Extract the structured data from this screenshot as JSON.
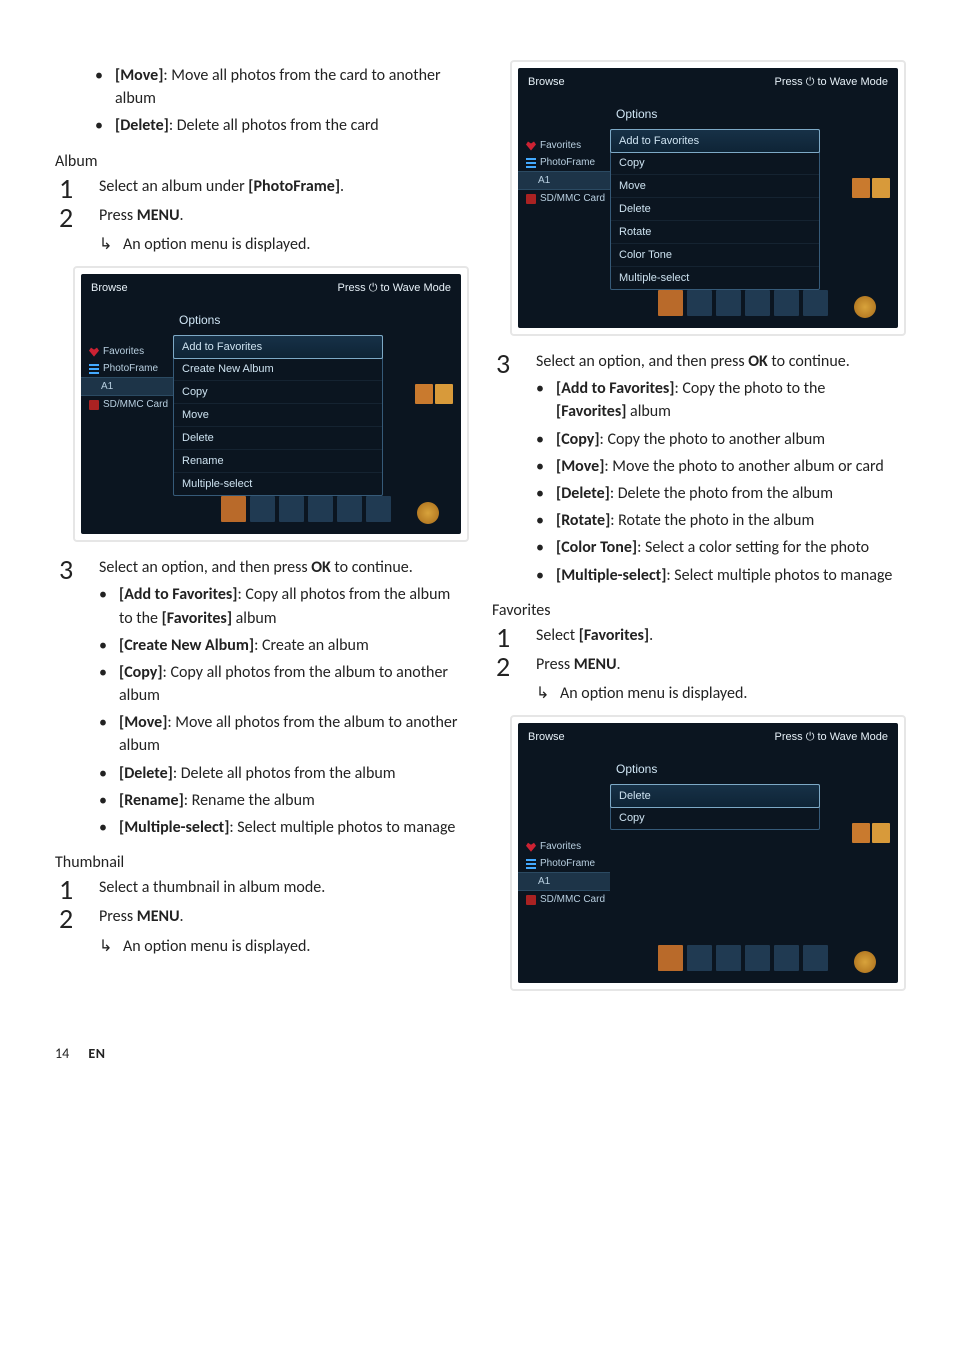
{
  "initial_bullets": [
    {
      "term": "[Move]",
      "desc": ": Move all photos from the card to another album"
    },
    {
      "term": "[Delete]",
      "desc": ": Delete all photos from the card"
    }
  ],
  "album": {
    "heading": "Album",
    "steps": [
      {
        "pre": "Select an album under ",
        "bold": "[PhotoFrame]",
        "post": "."
      },
      {
        "pre": "Press ",
        "bold": "MENU",
        "post": "."
      }
    ],
    "arrow": "An option menu is displayed.",
    "step3_pre": "Select an option, and then press ",
    "step3_bold": "OK",
    "step3_post": " to continue.",
    "bullets": [
      {
        "term": "[Add to Favorites]",
        "desc": ": Copy all photos from the album to the ",
        "bold2": "[Favorites]",
        "desc2": " album"
      },
      {
        "term": "[Create New Album]",
        "desc": ": Create an album"
      },
      {
        "term": "[Copy]",
        "desc": ": Copy all photos from the album to another album"
      },
      {
        "term": "[Move]",
        "desc": ": Move all photos from the album to another album"
      },
      {
        "term": "[Delete]",
        "desc": ": Delete all photos from the album"
      },
      {
        "term": "[Rename]",
        "desc": ": Rename the album"
      },
      {
        "term": "[Multiple-select]",
        "desc": ": Select multiple photos to manage"
      }
    ]
  },
  "thumbnail": {
    "heading": "Thumbnail",
    "steps": [
      {
        "text": "Select a thumbnail in album mode."
      },
      {
        "pre": "Press ",
        "bold": "MENU",
        "post": "."
      }
    ],
    "arrow": "An option menu is displayed.",
    "step3_pre": "Select an option, and then press ",
    "step3_bold": "OK",
    "step3_post": " to continue.",
    "bullets": [
      {
        "term": "[Add to Favorites]",
        "desc": ": Copy the photo to the ",
        "bold2": "[Favorites]",
        "desc2": " album"
      },
      {
        "term": "[Copy]",
        "desc": ": Copy the photo to another album"
      },
      {
        "term": "[Move]",
        "desc": ": Move the photo to another album or card"
      },
      {
        "term": "[Delete]",
        "desc": ": Delete the photo from the album"
      },
      {
        "term": "[Rotate]",
        "desc": ": Rotate the photo in the album"
      },
      {
        "term": "[Color Tone]",
        "desc": ": Select a color setting for the photo"
      },
      {
        "term": "[Multiple-select]",
        "desc": ": Select multiple photos to manage"
      }
    ]
  },
  "favorites": {
    "heading": "Favorites",
    "steps": [
      {
        "pre": "Select ",
        "bold": "[Favorites]",
        "post": "."
      },
      {
        "pre": "Press ",
        "bold": "MENU",
        "post": "."
      }
    ],
    "arrow": "An option menu is displayed."
  },
  "shot1": {
    "title": "Browse",
    "hint_pre": "Press ",
    "hint_icon": "⏻",
    "hint_post": " to Wave Mode",
    "menu_title": "Options",
    "items": [
      "Add to Favorites",
      "Create New Album",
      "Copy",
      "Move",
      "Delete",
      "Rename",
      "Multiple-select"
    ],
    "side": {
      "fav": "Favorites",
      "pf": "PhotoFrame",
      "a1": "A1",
      "sd": "SD/MMC Card"
    }
  },
  "shot2": {
    "title": "Browse",
    "hint_pre": "Press ",
    "hint_icon": "⏻",
    "hint_post": " to Wave Mode",
    "menu_title": "Options",
    "items": [
      "Add to Favorites",
      "Copy",
      "Move",
      "Delete",
      "Rotate",
      "Color Tone",
      "Multiple-select"
    ],
    "side": {
      "fav": "Favorites",
      "pf": "PhotoFrame",
      "a1": "A1",
      "sd": "SD/MMC Card"
    }
  },
  "shot3": {
    "title": "Browse",
    "hint_pre": "Press ",
    "hint_icon": "⏻",
    "hint_post": " to Wave Mode",
    "menu_title": "Options",
    "items": [
      "Delete",
      "Copy"
    ],
    "side": {
      "fav": "Favorites",
      "pf": "PhotoFrame",
      "a1": "A1",
      "sd": "SD/MMC Card"
    }
  },
  "footer": {
    "page": "14",
    "lang": "EN"
  }
}
